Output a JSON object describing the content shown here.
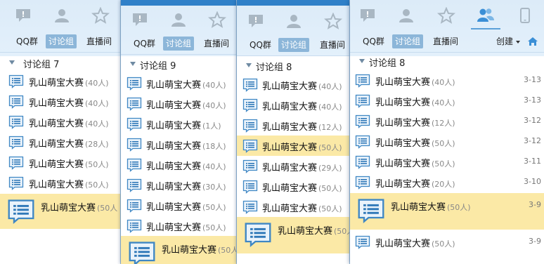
{
  "tabs": [
    "QQ群",
    "讨论组",
    "直播间"
  ],
  "create_label": "创建",
  "panels": [
    {
      "group": "讨论组 7",
      "items": [
        {
          "name": "乳山萌宝大赛",
          "count": "(40人)"
        },
        {
          "name": "乳山萌宝大赛",
          "count": "(40人)"
        },
        {
          "name": "乳山萌宝大赛",
          "count": "(40人)"
        },
        {
          "name": "乳山萌宝大赛",
          "count": "(28人)"
        },
        {
          "name": "乳山萌宝大赛",
          "count": "(50人)"
        },
        {
          "name": "乳山萌宝大赛",
          "count": "(50人)"
        },
        {
          "name": "乳山萌宝大赛",
          "count": "(50人"
        }
      ]
    },
    {
      "group": "讨论组 9",
      "items": [
        {
          "name": "乳山萌宝大赛",
          "count": "(40人)"
        },
        {
          "name": "乳山萌宝大赛",
          "count": "(40人)"
        },
        {
          "name": "乳山萌宝大赛",
          "count": "(1人)"
        },
        {
          "name": "乳山萌宝大赛",
          "count": "(18人)"
        },
        {
          "name": "乳山萌宝大赛",
          "count": "(40人)"
        },
        {
          "name": "乳山萌宝大赛",
          "count": "(30人)"
        },
        {
          "name": "乳山萌宝大赛",
          "count": "(50人)"
        },
        {
          "name": "乳山萌宝大赛",
          "count": "(50人)"
        },
        {
          "name": "乳山萌宝大赛",
          "count": "(50人"
        }
      ]
    },
    {
      "group": "讨论组 8",
      "items": [
        {
          "name": "乳山萌宝大赛",
          "count": "(40人)"
        },
        {
          "name": "乳山萌宝大赛",
          "count": "(40人)"
        },
        {
          "name": "乳山萌宝大赛",
          "count": "(12人)"
        },
        {
          "name": "乳山萌宝大赛",
          "count": "(50人)"
        },
        {
          "name": "乳山萌宝大赛",
          "count": "(29人)"
        },
        {
          "name": "乳山萌宝大赛",
          "count": "(50人)"
        },
        {
          "name": "乳山萌宝大赛",
          "count": "(50人)"
        },
        {
          "name": "乳山萌宝大赛",
          "count": "(50人"
        }
      ]
    },
    {
      "group": "讨论组 8",
      "items": [
        {
          "name": "乳山萌宝大赛",
          "count": "(40人)",
          "date": "3-13"
        },
        {
          "name": "乳山萌宝大赛",
          "count": "(40人)",
          "date": "3-13"
        },
        {
          "name": "乳山萌宝大赛",
          "count": "(12人)",
          "date": "3-12"
        },
        {
          "name": "乳山萌宝大赛",
          "count": "(50人)",
          "date": "3-12"
        },
        {
          "name": "乳山萌宝大赛",
          "count": "(50人)",
          "date": "3-11"
        },
        {
          "name": "乳山萌宝大赛",
          "count": "(20人)",
          "date": "3-10"
        },
        {
          "name": "乳山萌宝大赛",
          "count": "(50人)",
          "date": "3-9"
        },
        {
          "name": "乳山萌宝大赛",
          "count": "(50人)",
          "date": "3-9"
        }
      ]
    }
  ]
}
